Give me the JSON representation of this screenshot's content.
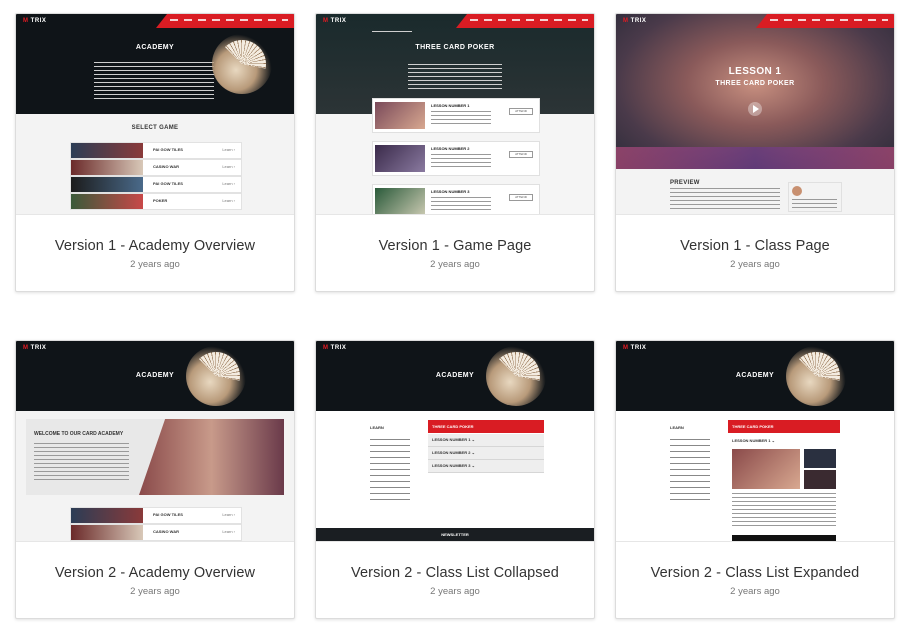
{
  "brand": {
    "logo": "TRIX",
    "accent": "#d91c23"
  },
  "cards": [
    {
      "title": "Version 1 - Academy Overview",
      "time": "2 years ago",
      "preview": {
        "hero_title": "ACADEMY",
        "section": "SELECT GAME",
        "rows": [
          "PAI GOW TILES",
          "CASINO WAR",
          "PAI GOW TILES",
          "POKER"
        ]
      }
    },
    {
      "title": "Version 1 - Game Page",
      "time": "2 years ago",
      "preview": {
        "hero_title": "THREE CARD POKER",
        "lessons": [
          "LESSON NUMBER 1",
          "LESSON NUMBER 2",
          "LESSON NUMBER 3"
        ]
      }
    },
    {
      "title": "Version 1 - Class Page",
      "time": "2 years ago",
      "preview": {
        "hero_title": "LESSON 1",
        "hero_sub": "THREE CARD POKER",
        "section": "PREVIEW"
      }
    },
    {
      "title": "Version 2 - Academy Overview",
      "time": "2 years ago",
      "preview": {
        "hero_title": "ACADEMY",
        "banner": "WELCOME TO OUR CARD ACADEMY",
        "rows": [
          "PAI GOW TILES",
          "CASINO WAR"
        ]
      }
    },
    {
      "title": "Version 2 - Class List Collapsed",
      "time": "2 years ago",
      "preview": {
        "hero_title": "ACADEMY",
        "sidebar": "LEARN",
        "menu_head": "THREE CARD POKER",
        "lessons": [
          "LESSON NUMBER 1",
          "LESSON NUMBER 2",
          "LESSON NUMBER 3"
        ],
        "footer": "NEWSLETTER"
      }
    },
    {
      "title": "Version 2 - Class List Expanded",
      "time": "2 years ago",
      "preview": {
        "hero_title": "ACADEMY",
        "sidebar": "LEARN",
        "menu_head": "THREE CARD POKER",
        "lessons": [
          "LESSON NUMBER 1"
        ]
      }
    }
  ]
}
